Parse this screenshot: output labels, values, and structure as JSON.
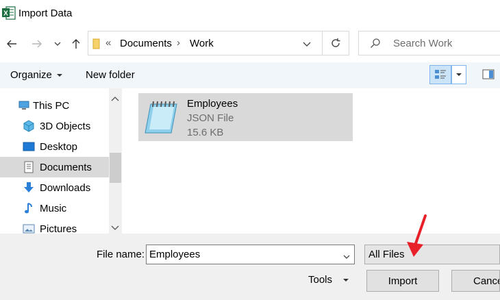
{
  "window": {
    "title": "Import Data",
    "app_icon": "excel-icon"
  },
  "nav": {
    "back_icon": "arrow-left-icon",
    "forward_icon": "arrow-right-icon",
    "recent_icon": "chevron-down-icon",
    "up_icon": "arrow-up-icon",
    "breadcrumb_overflow": "«",
    "breadcrumb": [
      "Documents",
      "Work"
    ],
    "separator": "›",
    "search_placeholder": "Search Work"
  },
  "toolbar": {
    "organize": "Organize",
    "new_folder": "New folder"
  },
  "tree": [
    {
      "label": "This PC",
      "icon": "computer-icon"
    },
    {
      "label": "3D Objects",
      "icon": "cube-icon"
    },
    {
      "label": "Desktop",
      "icon": "desktop-icon"
    },
    {
      "label": "Documents",
      "icon": "document-icon",
      "selected": true
    },
    {
      "label": "Downloads",
      "icon": "download-icon"
    },
    {
      "label": "Music",
      "icon": "music-icon"
    },
    {
      "label": "Pictures",
      "icon": "pictures-icon"
    }
  ],
  "files": [
    {
      "name": "Employees",
      "type": "JSON File",
      "size": "15.6 KB",
      "icon": "notepad-icon"
    }
  ],
  "footer": {
    "file_name_label": "File name:",
    "file_name_value": "Employees",
    "filter_value": "All Files",
    "tools": "Tools",
    "import": "Import",
    "cancel": "Cancel"
  },
  "colors": {
    "accent_arrow": "#e8202a",
    "selected": "#d9d9d9",
    "toolbar_bg": "#f1f6fb"
  }
}
